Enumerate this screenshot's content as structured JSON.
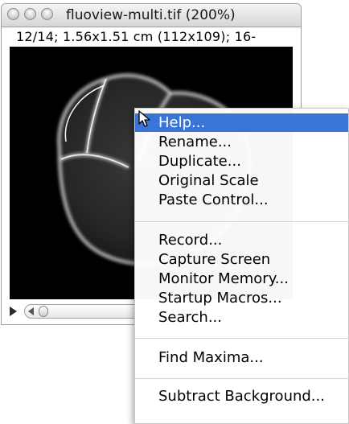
{
  "window": {
    "title": "fluoview-multi.tif (200%)",
    "info": "12/14; 1.56x1.51 cm (112x109); 16-"
  },
  "menu": {
    "items": [
      {
        "label": "Help...",
        "highlighted": true
      },
      {
        "label": "Rename..."
      },
      {
        "label": "Duplicate..."
      },
      {
        "label": "Original Scale"
      },
      {
        "label": "Paste Control..."
      },
      {
        "label": "Record..."
      },
      {
        "label": "Capture Screen"
      },
      {
        "label": "Monitor Memory..."
      },
      {
        "label": "Startup Macros..."
      },
      {
        "label": "Search..."
      },
      {
        "label": "Find Maxima..."
      },
      {
        "label": "Subtract Background..."
      }
    ]
  },
  "colors": {
    "highlight": "#3875d7",
    "canvas_bg": "#000000"
  },
  "icons": {
    "play": "play-icon",
    "scroll_left": "scroll-left-icon",
    "cursor": "mouse-cursor-icon"
  }
}
